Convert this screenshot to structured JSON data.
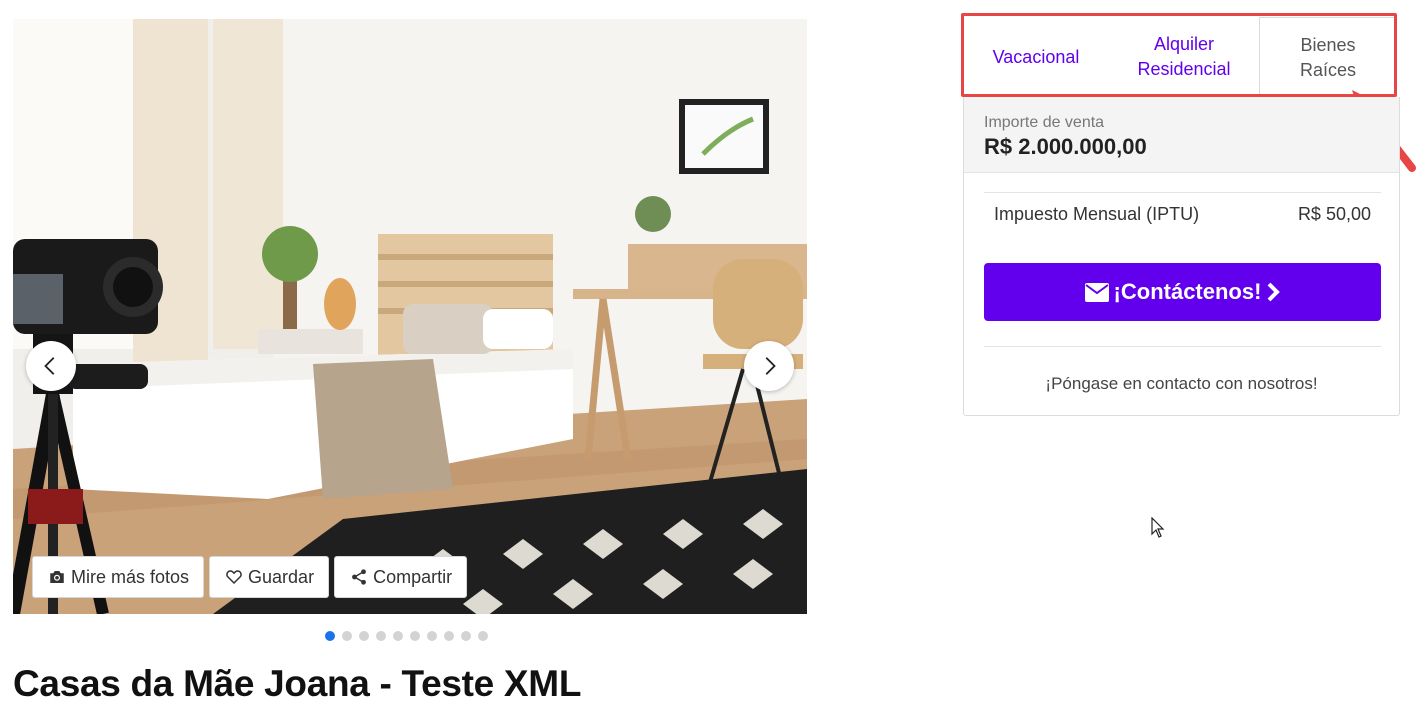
{
  "gallery": {
    "photo_count": 10,
    "active_photo": 1,
    "actions": {
      "more_photos": "Mire más fotos",
      "save": "Guardar",
      "share": "Compartir"
    },
    "icons": {
      "more_photos": "camera-icon",
      "save": "heart-icon",
      "share": "share-icon",
      "prev": "chevron-left-icon",
      "next": "chevron-right-icon"
    }
  },
  "listing": {
    "title": "Casas da Mãe Joana - Teste XML"
  },
  "tabs": [
    {
      "line1": "Vacacional",
      "line2": "",
      "active": false
    },
    {
      "line1": "Alquiler",
      "line2": "Residencial",
      "active": false
    },
    {
      "line1": "Bienes",
      "line2": "Raíces",
      "active": true
    }
  ],
  "price_card": {
    "price_label": "Importe de venta",
    "price_value": "R$ 2.000.000,00",
    "tax_label": "Impuesto Mensual (IPTU)",
    "tax_value": "R$ 50,00",
    "contact_button": "¡Contáctenos!",
    "contact_button_icons": [
      "envelope-icon",
      "chevron-right-icon"
    ],
    "contact_text": "¡Póngase en contacto con nosotros!"
  },
  "colors": {
    "accent": "#6200ee",
    "annotation": "#e84545",
    "dot_active": "#1a73e8",
    "dot_inactive": "#d3d3d3"
  }
}
